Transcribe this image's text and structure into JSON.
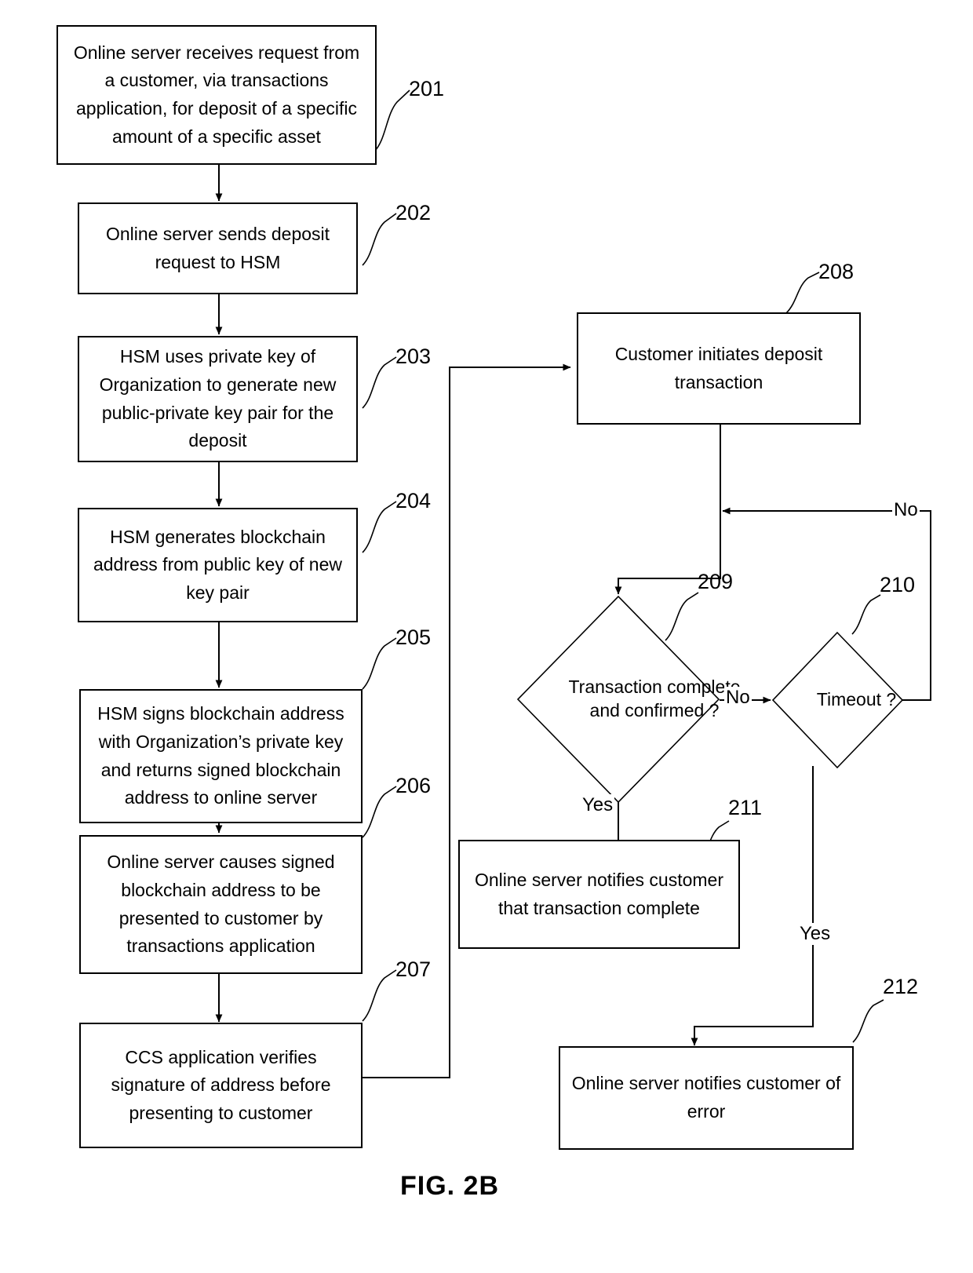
{
  "figure": {
    "caption": "FIG. 2B"
  },
  "nodes": [
    {
      "id": "201",
      "ref": "201",
      "shape": "process",
      "text": "Online server receives request from a customer, via transactions application, for deposit of a specific amount of a specific asset"
    },
    {
      "id": "202",
      "ref": "202",
      "shape": "process",
      "text": "Online server sends deposit request to HSM"
    },
    {
      "id": "203",
      "ref": "203",
      "shape": "process",
      "text": "HSM uses private key of Organization to generate new public-private key pair for the deposit"
    },
    {
      "id": "204",
      "ref": "204",
      "shape": "process",
      "text": "HSM generates blockchain address from public key of new key pair"
    },
    {
      "id": "205",
      "ref": "205",
      "shape": "process",
      "text": "HSM signs blockchain address with Organization’s private key and returns signed blockchain address to online server"
    },
    {
      "id": "206",
      "ref": "206",
      "shape": "process",
      "text": "Online server causes signed blockchain address to be presented to customer by transactions application"
    },
    {
      "id": "207",
      "ref": "207",
      "shape": "process",
      "text": "CCS application verifies signature of address before presenting to customer"
    },
    {
      "id": "208",
      "ref": "208",
      "shape": "process",
      "text": "Customer initiates deposit transaction"
    },
    {
      "id": "209",
      "ref": "209",
      "shape": "decision",
      "text": "Transaction complete and confirmed ?"
    },
    {
      "id": "210",
      "ref": "210",
      "shape": "decision",
      "text": "Timeout ?"
    },
    {
      "id": "211",
      "ref": "211",
      "shape": "process",
      "text": "Online server notifies customer that transaction complete"
    },
    {
      "id": "212",
      "ref": "212",
      "shape": "process",
      "text": "Online server notifies customer of error"
    }
  ],
  "edge_labels": {
    "decision209_no": "No",
    "decision209_yes": "Yes",
    "decision210_no": "No",
    "decision210_yes": "Yes"
  },
  "colors": {
    "stroke": "#000000",
    "background": "#ffffff",
    "text": "#000000"
  }
}
